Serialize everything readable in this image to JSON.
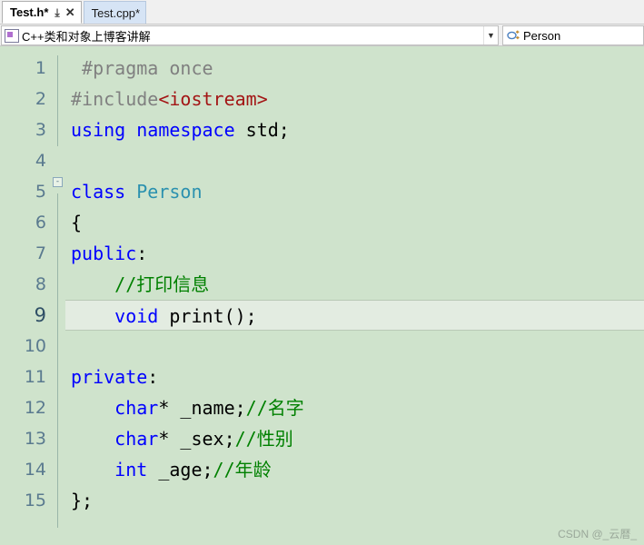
{
  "tabs": [
    {
      "label": "Test.h*",
      "active": true,
      "pin": "⤓",
      "close": "✕"
    },
    {
      "label": "Test.cpp*",
      "active": false,
      "pin": "",
      "close": ""
    }
  ],
  "navbar": {
    "project_combo": {
      "icon": "project-icon",
      "text": "C++类和对象上博客讲解",
      "arrow": "▼"
    },
    "member_combo": {
      "icon": "class-icon",
      "text": "Person",
      "arrow": ""
    }
  },
  "editor": {
    "line_numbers": [
      "1",
      "2",
      "3",
      "4",
      "5",
      "6",
      "7",
      "8",
      "9",
      "10",
      "11",
      "12",
      "13",
      "14",
      "15"
    ],
    "current_line": 9,
    "fold_marker": "-",
    "lines": [
      {
        "n": 1,
        "tokens": [
          {
            "t": "    ",
            "c": "plain"
          },
          {
            "t": "#pragma once",
            "c": "pre"
          }
        ]
      },
      {
        "n": 2,
        "tokens": [
          {
            "t": "    ",
            "c": "plain"
          },
          {
            "t": "#include",
            "c": "pre"
          },
          {
            "t": "<iostream>",
            "c": "str"
          }
        ]
      },
      {
        "n": 3,
        "tokens": [
          {
            "t": "    ",
            "c": "plain"
          },
          {
            "t": "using",
            "c": "kw"
          },
          {
            "t": " ",
            "c": "plain"
          },
          {
            "t": "namespace",
            "c": "kw"
          },
          {
            "t": " std;",
            "c": "plain"
          }
        ]
      },
      {
        "n": 4,
        "tokens": []
      },
      {
        "n": 5,
        "tokens": [
          {
            "t": "   ",
            "c": "plain"
          },
          {
            "t": "class",
            "c": "kw"
          },
          {
            "t": " ",
            "c": "plain"
          },
          {
            "t": "Person",
            "c": "type"
          }
        ]
      },
      {
        "n": 6,
        "tokens": [
          {
            "t": "   {",
            "c": "plain"
          }
        ]
      },
      {
        "n": 7,
        "tokens": [
          {
            "t": "   ",
            "c": "plain"
          },
          {
            "t": "public",
            "c": "kw"
          },
          {
            "t": ":",
            "c": "plain"
          }
        ]
      },
      {
        "n": 8,
        "tokens": [
          {
            "t": "       ",
            "c": "plain"
          },
          {
            "t": "//打印信息",
            "c": "cmt"
          }
        ]
      },
      {
        "n": 9,
        "tokens": [
          {
            "t": "       ",
            "c": "plain"
          },
          {
            "t": "void",
            "c": "kw"
          },
          {
            "t": " print();",
            "c": "plain"
          }
        ]
      },
      {
        "n": 10,
        "tokens": []
      },
      {
        "n": 11,
        "tokens": [
          {
            "t": "   ",
            "c": "plain"
          },
          {
            "t": "private",
            "c": "kw"
          },
          {
            "t": ":",
            "c": "plain"
          }
        ]
      },
      {
        "n": 12,
        "tokens": [
          {
            "t": "       ",
            "c": "plain"
          },
          {
            "t": "char",
            "c": "kw"
          },
          {
            "t": "* _name;",
            "c": "plain"
          },
          {
            "t": "//名字",
            "c": "cmt"
          }
        ]
      },
      {
        "n": 13,
        "tokens": [
          {
            "t": "       ",
            "c": "plain"
          },
          {
            "t": "char",
            "c": "kw"
          },
          {
            "t": "* _sex;",
            "c": "plain"
          },
          {
            "t": "//性别",
            "c": "cmt"
          }
        ]
      },
      {
        "n": 14,
        "tokens": [
          {
            "t": "       ",
            "c": "plain"
          },
          {
            "t": "int",
            "c": "kw"
          },
          {
            "t": " _age;",
            "c": "plain"
          },
          {
            "t": "//年龄",
            "c": "cmt"
          }
        ]
      },
      {
        "n": 15,
        "tokens": [
          {
            "t": "   };",
            "c": "plain"
          }
        ]
      }
    ],
    "watermark": "CSDN @_云暦_"
  },
  "colors": {
    "editor_background": "#cfe3cc",
    "current_line_background": "#e3ece1",
    "keyword": "#0000ff",
    "type": "#2b91af",
    "comment": "#008000",
    "string": "#a31515",
    "preprocessor": "#808080",
    "line_number": "#5a7a8f",
    "tab_inactive": "#d6e4f5"
  }
}
